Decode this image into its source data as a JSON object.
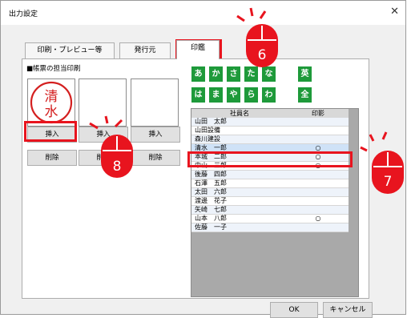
{
  "window": {
    "title": "出力設定",
    "close_glyph": "✕"
  },
  "tabs": [
    {
      "label": "印刷・プレビュー等"
    },
    {
      "label": "発行元"
    },
    {
      "label": "印鑑"
    }
  ],
  "section": {
    "title": "■帳票の担当印刷"
  },
  "stamp": {
    "text": "清水",
    "color": "#d42020"
  },
  "buttons": {
    "insert": "挿入",
    "delete": "削除"
  },
  "kana_buttons": [
    "あ",
    "か",
    "さ",
    "た",
    "な",
    "英",
    "は",
    "ま",
    "や",
    "ら",
    "わ",
    "全"
  ],
  "grid": {
    "headers": [
      "社員名",
      "印影"
    ],
    "rows": [
      {
        "name": "山田　太郎",
        "stamp": ""
      },
      {
        "name": "山田設備",
        "stamp": ""
      },
      {
        "name": "森川建設",
        "stamp": ""
      },
      {
        "name": "清水　一郎",
        "stamp": "○"
      },
      {
        "name": "本城　二郎",
        "stamp": "○"
      },
      {
        "name": "中山　三郎",
        "stamp": "○"
      },
      {
        "name": "後藤　四郎",
        "stamp": ""
      },
      {
        "name": "石澤　五郎",
        "stamp": ""
      },
      {
        "name": "太田　六郎",
        "stamp": ""
      },
      {
        "name": "渡邊　花子",
        "stamp": ""
      },
      {
        "name": "矢崎　七郎",
        "stamp": ""
      },
      {
        "name": "山本　八郎",
        "stamp": "○"
      },
      {
        "name": "佐藤　一子",
        "stamp": ""
      }
    ]
  },
  "footer": {
    "ok": "OK",
    "cancel": "キャンセル"
  },
  "callouts": {
    "six": "6",
    "seven": "7",
    "eight": "8"
  },
  "colors": {
    "highlight": "#e8141e",
    "kana_green": "#1e9a3a",
    "selected_row": "#cfe2f7"
  }
}
